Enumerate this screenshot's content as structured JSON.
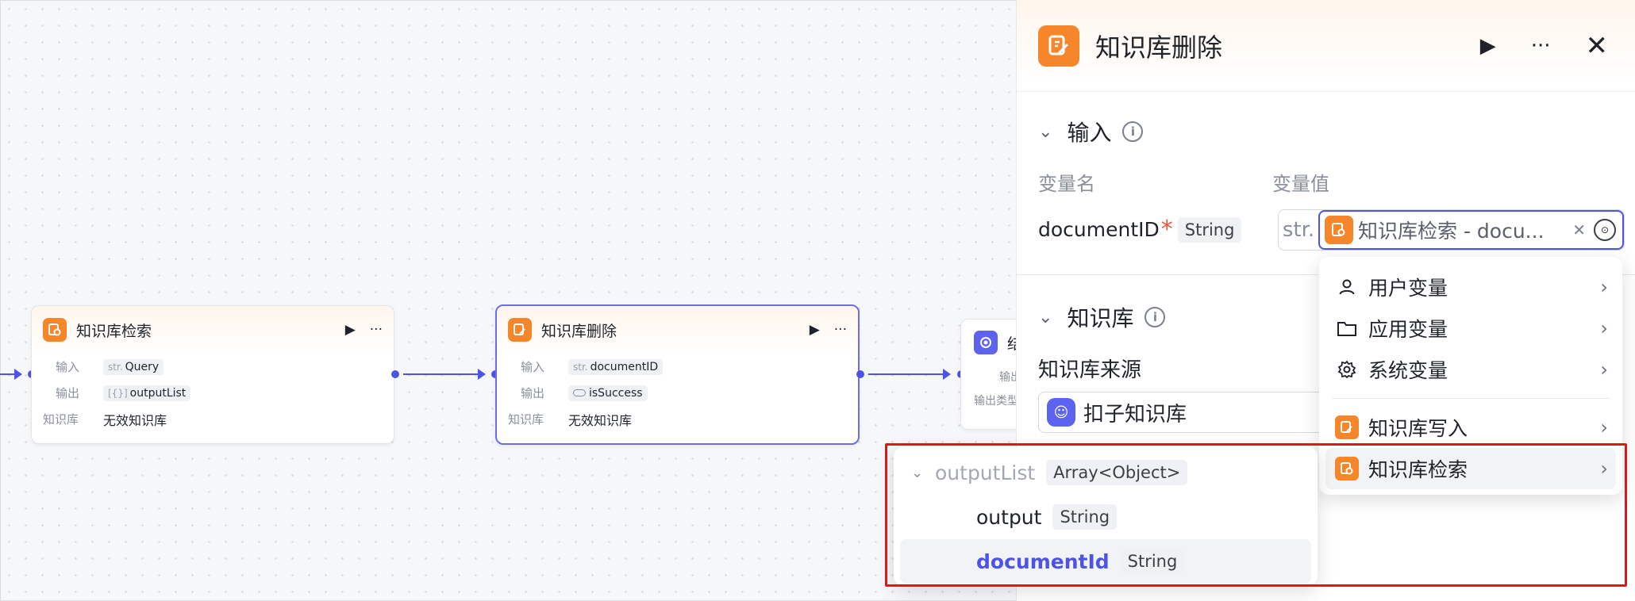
{
  "canvas": {
    "node1": {
      "title": "知识库检索",
      "input_label": "输入",
      "input_type": "str.",
      "input_value": "Query",
      "output_label": "输出",
      "output_type": "[{}]",
      "output_value": "outputList",
      "kb_label": "知识库",
      "kb_value": "无效知识库"
    },
    "node2": {
      "title": "知识库删除",
      "input_label": "输入",
      "input_type": "str.",
      "input_value": "documentID",
      "output_label": "输出",
      "output_value": "isSuccess",
      "kb_label": "知识库",
      "kb_value": "无效知识库"
    },
    "node3": {
      "title_fragment": "结",
      "row1_fragment": "输出",
      "row2_fragment": "输出类型"
    }
  },
  "panel": {
    "title": "知识库删除",
    "input_section": {
      "title": "输入",
      "col_name": "变量名",
      "col_value": "变量值",
      "var_name": "documentID",
      "var_type": "String",
      "value_prefix": "str.",
      "value_ref": "知识库检索 - docu..."
    },
    "kb_section": {
      "title": "知识库",
      "source_label": "知识库来源",
      "source_value": "扣子知识库"
    }
  },
  "menu": {
    "items": [
      {
        "label": "用户变量",
        "icon": "user-icon"
      },
      {
        "label": "应用变量",
        "icon": "folder-icon"
      },
      {
        "label": "系统变量",
        "icon": "gear-icon"
      },
      {
        "label": "知识库写入",
        "icon": "kb-write-icon"
      },
      {
        "label": "知识库检索",
        "icon": "kb-search-icon"
      }
    ]
  },
  "submenu": {
    "parent": {
      "name": "outputList",
      "type": "Array<Object>"
    },
    "children": [
      {
        "name": "output",
        "type": "String"
      },
      {
        "name": "documentId",
        "type": "String"
      }
    ]
  },
  "colors": {
    "accent": "#4d53e8",
    "node_icon": "#f5862a",
    "highlight_box": "#e0161d"
  }
}
